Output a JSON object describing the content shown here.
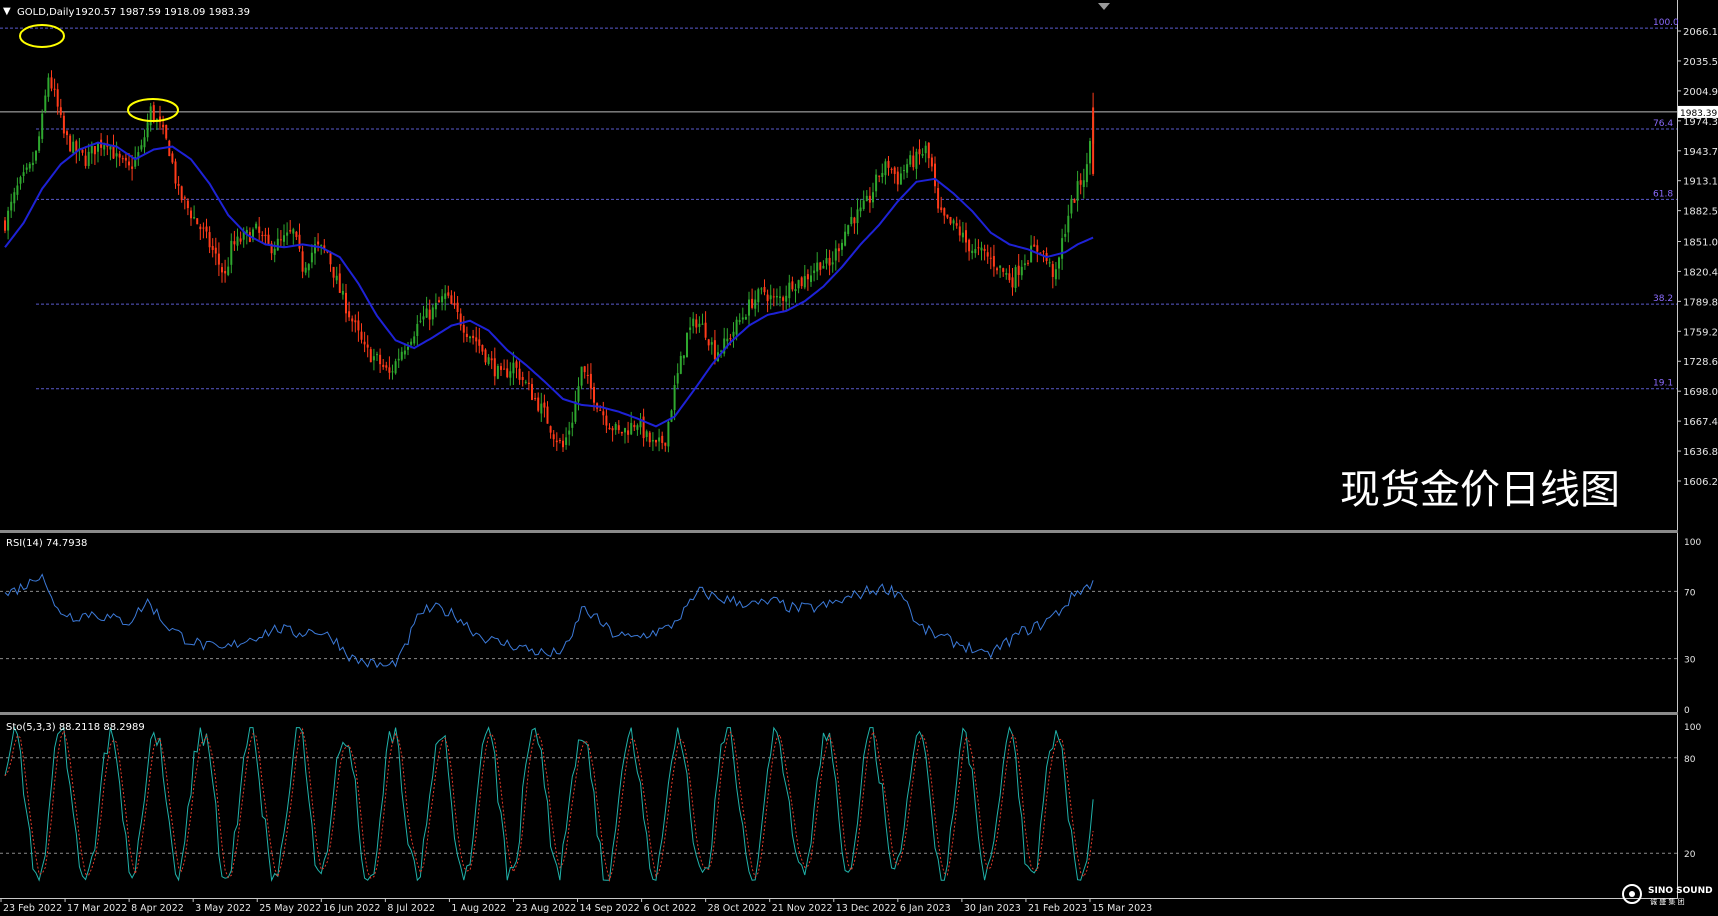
{
  "chart_data": [
    {
      "id": "price",
      "type": "candlestick",
      "title": "GOLD,Daily",
      "ohlc_header": "1920.57 1987.59 1918.09 1983.39",
      "annotation_text": "现货金价日线图",
      "yticks": [
        2066.1,
        2035.5,
        2004.9,
        1974.3,
        1943.7,
        1913.1,
        1882.5,
        1851.0,
        1820.4,
        1789.8,
        1759.2,
        1728.6,
        1698.0,
        1667.4,
        1636.8,
        1606.2
      ],
      "ylim": [
        1606.2,
        2073
      ],
      "price_label": "1983.39",
      "xticks": [
        "23 Feb 2022",
        "17 Mar 2022",
        "8 Apr 2022",
        "3 May 2022",
        "25 May 2022",
        "16 Jun 2022",
        "8 Jul 2022",
        "1 Aug 2022",
        "23 Aug 2022",
        "14 Sep 2022",
        "6 Oct 2022",
        "28 Oct 2022",
        "21 Nov 2022",
        "13 Dec 2022",
        "6 Jan 2023",
        "30 Jan 2023",
        "21 Feb 2023",
        "15 Mar 2023"
      ],
      "fib_levels": [
        {
          "label": "100.0",
          "price": 2069.0
        },
        {
          "label": "76.4",
          "price": 1966.0
        },
        {
          "label": "61.8",
          "price": 1894.0
        },
        {
          "label": "38.2",
          "price": 1787.0
        },
        {
          "label": "19.1",
          "price": 1700.5
        }
      ],
      "current_price_line": 1983.39,
      "close_path": [
        [
          0,
          1870
        ],
        [
          4,
          1905
        ],
        [
          8,
          1925
        ],
        [
          10,
          1940
        ],
        [
          12,
          1975
        ],
        [
          14,
          2020
        ],
        [
          16,
          2000
        ],
        [
          19,
          1960
        ],
        [
          22,
          1945
        ],
        [
          26,
          1935
        ],
        [
          30,
          1950
        ],
        [
          33,
          1955
        ],
        [
          36,
          1935
        ],
        [
          40,
          1925
        ],
        [
          44,
          1945
        ],
        [
          47,
          1985
        ],
        [
          50,
          1968
        ],
        [
          53,
          1945
        ],
        [
          56,
          1900
        ],
        [
          60,
          1880
        ],
        [
          64,
          1860
        ],
        [
          68,
          1835
        ],
        [
          71,
          1815
        ],
        [
          73,
          1845
        ],
        [
          77,
          1855
        ],
        [
          81,
          1862
        ],
        [
          85,
          1845
        ],
        [
          89,
          1850
        ],
        [
          93,
          1860
        ],
        [
          96,
          1825
        ],
        [
          100,
          1845
        ],
        [
          104,
          1840
        ],
        [
          108,
          1800
        ],
        [
          112,
          1770
        ],
        [
          116,
          1740
        ],
        [
          120,
          1730
        ],
        [
          124,
          1715
        ],
        [
          128,
          1740
        ],
        [
          131,
          1755
        ],
        [
          134,
          1770
        ],
        [
          138,
          1780
        ],
        [
          142,
          1795
        ],
        [
          145,
          1780
        ],
        [
          149,
          1760
        ],
        [
          152,
          1750
        ],
        [
          156,
          1730
        ],
        [
          160,
          1712
        ],
        [
          164,
          1725
        ],
        [
          168,
          1705
        ],
        [
          171,
          1690
        ],
        [
          174,
          1675
        ],
        [
          177,
          1655
        ],
        [
          180,
          1640
        ],
        [
          183,
          1670
        ],
        [
          186,
          1720
        ],
        [
          189,
          1700
        ],
        [
          192,
          1680
        ],
        [
          195,
          1665
        ],
        [
          198,
          1655
        ],
        [
          201,
          1660
        ],
        [
          204,
          1668
        ],
        [
          207,
          1650
        ],
        [
          210,
          1640
        ],
        [
          213,
          1650
        ],
        [
          216,
          1700
        ],
        [
          220,
          1755
        ],
        [
          223,
          1770
        ],
        [
          226,
          1760
        ],
        [
          229,
          1738
        ],
        [
          232,
          1745
        ],
        [
          235,
          1760
        ],
        [
          238,
          1775
        ],
        [
          241,
          1790
        ],
        [
          245,
          1800
        ],
        [
          248,
          1790
        ],
        [
          251,
          1795
        ],
        [
          254,
          1810
        ],
        [
          257,
          1810
        ],
        [
          260,
          1820
        ],
        [
          263,
          1830
        ],
        [
          266,
          1825
        ],
        [
          270,
          1855
        ],
        [
          273,
          1875
        ],
        [
          276,
          1880
        ],
        [
          279,
          1895
        ],
        [
          282,
          1920
        ],
        [
          285,
          1930
        ],
        [
          288,
          1915
        ],
        [
          291,
          1930
        ],
        [
          294,
          1935
        ],
        [
          297,
          1945
        ],
        [
          299,
          1925
        ],
        [
          301,
          1880
        ],
        [
          304,
          1870
        ],
        [
          307,
          1865
        ],
        [
          310,
          1850
        ],
        [
          313,
          1840
        ],
        [
          316,
          1838
        ],
        [
          319,
          1830
        ],
        [
          322,
          1820
        ],
        [
          325,
          1812
        ],
        [
          328,
          1830
        ],
        [
          331,
          1840
        ],
        [
          334,
          1845
        ],
        [
          337,
          1825
        ],
        [
          339,
          1815
        ],
        [
          341,
          1850
        ],
        [
          343,
          1880
        ],
        [
          346,
          1905
        ],
        [
          349,
          1925
        ],
        [
          351,
          1983
        ]
      ],
      "n_bars": 352,
      "ma_path": [
        [
          0,
          1845
        ],
        [
          6,
          1870
        ],
        [
          12,
          1905
        ],
        [
          18,
          1930
        ],
        [
          24,
          1945
        ],
        [
          30,
          1952
        ],
        [
          36,
          1948
        ],
        [
          42,
          1935
        ],
        [
          48,
          1945
        ],
        [
          54,
          1948
        ],
        [
          60,
          1935
        ],
        [
          66,
          1910
        ],
        [
          72,
          1878
        ],
        [
          78,
          1858
        ],
        [
          84,
          1848
        ],
        [
          90,
          1845
        ],
        [
          96,
          1848
        ],
        [
          102,
          1845
        ],
        [
          108,
          1835
        ],
        [
          114,
          1808
        ],
        [
          120,
          1775
        ],
        [
          126,
          1750
        ],
        [
          132,
          1742
        ],
        [
          138,
          1753
        ],
        [
          144,
          1765
        ],
        [
          150,
          1770
        ],
        [
          156,
          1760
        ],
        [
          162,
          1740
        ],
        [
          168,
          1725
        ],
        [
          174,
          1708
        ],
        [
          180,
          1690
        ],
        [
          186,
          1684
        ],
        [
          192,
          1682
        ],
        [
          198,
          1677
        ],
        [
          204,
          1670
        ],
        [
          210,
          1662
        ],
        [
          216,
          1672
        ],
        [
          222,
          1698
        ],
        [
          228,
          1725
        ],
        [
          234,
          1748
        ],
        [
          240,
          1765
        ],
        [
          246,
          1776
        ],
        [
          252,
          1780
        ],
        [
          258,
          1790
        ],
        [
          264,
          1805
        ],
        [
          270,
          1825
        ],
        [
          276,
          1848
        ],
        [
          282,
          1868
        ],
        [
          288,
          1892
        ],
        [
          294,
          1912
        ],
        [
          300,
          1915
        ],
        [
          306,
          1900
        ],
        [
          312,
          1882
        ],
        [
          318,
          1860
        ],
        [
          324,
          1848
        ],
        [
          330,
          1843
        ],
        [
          336,
          1835
        ],
        [
          342,
          1840
        ],
        [
          346,
          1848
        ],
        [
          351,
          1855
        ]
      ]
    },
    {
      "id": "rsi",
      "type": "line",
      "title": "RSI(14) 74.7938",
      "yticks": [
        100,
        70,
        30,
        0
      ],
      "ylim": [
        0,
        100
      ],
      "levels": [
        70,
        30
      ],
      "color": "#3c7ad8",
      "path": [
        [
          0,
          68
        ],
        [
          8,
          75
        ],
        [
          12,
          82
        ],
        [
          16,
          60
        ],
        [
          22,
          55
        ],
        [
          28,
          57
        ],
        [
          34,
          54
        ],
        [
          40,
          52
        ],
        [
          46,
          64
        ],
        [
          52,
          50
        ],
        [
          58,
          42
        ],
        [
          64,
          38
        ],
        [
          70,
          35
        ],
        [
          76,
          40
        ],
        [
          82,
          44
        ],
        [
          88,
          48
        ],
        [
          94,
          45
        ],
        [
          100,
          47
        ],
        [
          106,
          42
        ],
        [
          112,
          30
        ],
        [
          118,
          27
        ],
        [
          124,
          25
        ],
        [
          128,
          32
        ],
        [
          134,
          58
        ],
        [
          140,
          60
        ],
        [
          146,
          55
        ],
        [
          152,
          45
        ],
        [
          158,
          40
        ],
        [
          164,
          38
        ],
        [
          170,
          35
        ],
        [
          176,
          32
        ],
        [
          182,
          38
        ],
        [
          186,
          60
        ],
        [
          190,
          55
        ],
        [
          196,
          45
        ],
        [
          202,
          42
        ],
        [
          208,
          45
        ],
        [
          214,
          48
        ],
        [
          220,
          60
        ],
        [
          224,
          70
        ],
        [
          230,
          66
        ],
        [
          236,
          64
        ],
        [
          242,
          62
        ],
        [
          248,
          64
        ],
        [
          254,
          60
        ],
        [
          260,
          60
        ],
        [
          266,
          62
        ],
        [
          272,
          66
        ],
        [
          278,
          70
        ],
        [
          284,
          72
        ],
        [
          290,
          68
        ],
        [
          294,
          50
        ],
        [
          300,
          44
        ],
        [
          306,
          40
        ],
        [
          312,
          36
        ],
        [
          316,
          31
        ],
        [
          322,
          38
        ],
        [
          328,
          46
        ],
        [
          334,
          50
        ],
        [
          340,
          58
        ],
        [
          346,
          70
        ],
        [
          351,
          75
        ]
      ]
    },
    {
      "id": "sto",
      "type": "line",
      "title": "Sto(5,3,3) 88.2118 88.2989",
      "yticks": [
        100,
        80,
        20
      ],
      "ylim": [
        0,
        100
      ],
      "levels": [
        80,
        20
      ],
      "series": [
        {
          "name": "main",
          "color": "#20b2aa"
        },
        {
          "name": "signal",
          "color": "#e03a2a",
          "dashed": true
        }
      ]
    }
  ],
  "watermark": {
    "brand": "SINO SOUND",
    "sub": "诚 盛 集 团"
  },
  "colors": {
    "bull": "#2fa82f",
    "bear": "#ff3b1a",
    "ma": "#1e22d6",
    "grid_dash": "#5a5acc",
    "fib_text": "#8c6cff",
    "axis_text": "#e6e6e6",
    "highlight": "#ffff00"
  }
}
